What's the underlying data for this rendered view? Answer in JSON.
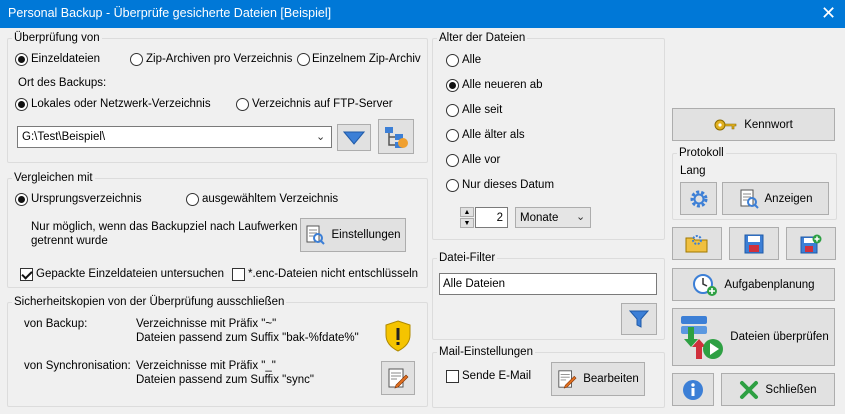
{
  "window": {
    "title": "Personal Backup - Überprüfe gesicherte Dateien [Beispiel]",
    "close_glyph": "✕"
  },
  "check_group": {
    "title": "Überprüfung von",
    "options": [
      "Einzeldateien",
      "Zip-Archiven pro Verzeichnis",
      "Einzelnem Zip-Archiv"
    ],
    "location_label": "Ort des Backups:",
    "location_options": [
      "Lokales oder Netzwerk-Verzeichnis",
      "Verzeichnis auf FTP-Server"
    ],
    "path_value": "G:\\Test\\Beispiel\\"
  },
  "compare_group": {
    "title": "Vergleichen mit",
    "options": [
      "Ursprungsverzeichnis",
      "ausgewähltem Verzeichnis"
    ],
    "note": [
      "Nur möglich, wenn das Backupziel nach Laufwerken",
      "getrennt wurde"
    ],
    "settings_label": "Einstellungen",
    "check_packed": "Gepackte Einzeldateien untersuchen",
    "check_enc": "*.enc-Dateien nicht entschlüsseln"
  },
  "exclude_group": {
    "title": "Sicherheitskopien von der Überprüfung ausschließen",
    "backup_label": "von Backup:",
    "backup_lines": [
      "Verzeichnisse mit Präfix \"~\"",
      "Dateien passend zum Suffix \"bak-%fdate%\""
    ],
    "sync_label": "von Synchronisation:",
    "sync_lines": [
      "Verzeichnisse mit Präfix \"_\"",
      "Dateien passend zum Suffix \"sync\""
    ]
  },
  "age_group": {
    "title": "Alter der Dateien",
    "options": [
      "Alle",
      "Alle neueren ab",
      "Alle seit",
      "Alle älter als",
      "Alle vor",
      "Nur dieses Datum"
    ],
    "spin_value": "2",
    "unit_value": "Monate"
  },
  "filter_group": {
    "title": "Datei-Filter",
    "value": "Alle Dateien"
  },
  "mail_group": {
    "title": "Mail-Einstellungen",
    "send_label": "Sende E-Mail",
    "edit_label": "Bearbeiten"
  },
  "right_panel": {
    "password_label": "Kennwort",
    "protocol_title": "Protokoll",
    "protocol_level": "Lang",
    "show_label": "Anzeigen",
    "schedule_label": "Aufgabenplanung",
    "verify_label": "Dateien überprüfen",
    "close_label": "Schließen"
  },
  "colors": {
    "titlebar": "#0078d7",
    "accent_blue": "#3c7fd6",
    "warning_yellow": "#f5c400",
    "go_green": "#2ea043"
  }
}
